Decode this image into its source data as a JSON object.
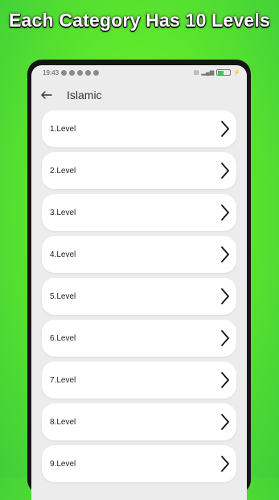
{
  "headline": "Each Category Has 10 Levels",
  "status_bar": {
    "time": "19:43",
    "battery": "57"
  },
  "app_bar": {
    "title": "Islamic"
  },
  "levels": [
    "1.Level",
    "2.Level",
    "3.Level",
    "4.Level",
    "5.Level",
    "6.Level",
    "7.Level",
    "8.Level",
    "9.Level"
  ],
  "icons": {
    "back": "back-arrow-icon",
    "chevron": "chevron-right-icon"
  },
  "colors": {
    "background": "#6cf02b",
    "phone_frame": "#161616",
    "screen_bg": "#ececec",
    "card_bg": "#ffffff"
  }
}
